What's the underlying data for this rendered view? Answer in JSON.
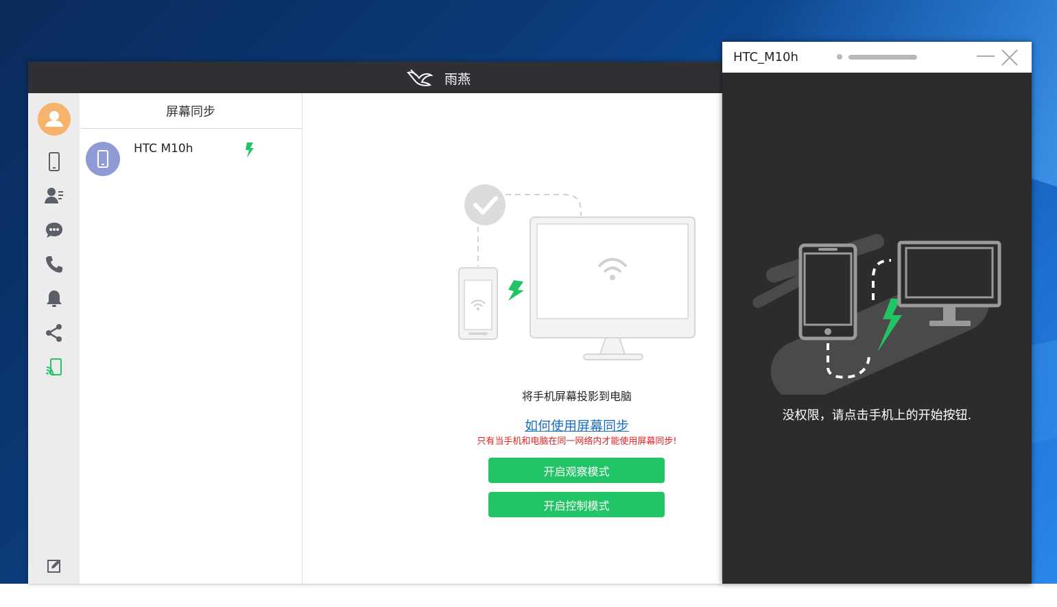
{
  "app": {
    "title": "雨燕",
    "list_header": "屏幕同步",
    "device_name": "HTC M10h"
  },
  "nav": {
    "items": [
      "avatar-icon",
      "phone-icon",
      "contacts-icon",
      "messages-icon",
      "call-icon",
      "notification-icon",
      "share-icon",
      "screen-sync-icon",
      "edit-icon"
    ]
  },
  "content": {
    "caption": "将手机屏幕投影到电脑",
    "howto_link": "如何使用屏幕同步",
    "warning": "只有当手机和电脑在同一网络内才能使用屏幕同步!",
    "btn_watch": "开启观察模式",
    "btn_control": "开启控制模式"
  },
  "mirror": {
    "title": "HTC_M10h",
    "message": "没权限，请点击手机上的开始按钮."
  },
  "colors": {
    "accent_green": "#22c566",
    "link_blue": "#1a6fc4",
    "warning_red": "#e02020",
    "titlebar_dark": "#2f3033",
    "mirror_bg": "#2c2c2c"
  }
}
